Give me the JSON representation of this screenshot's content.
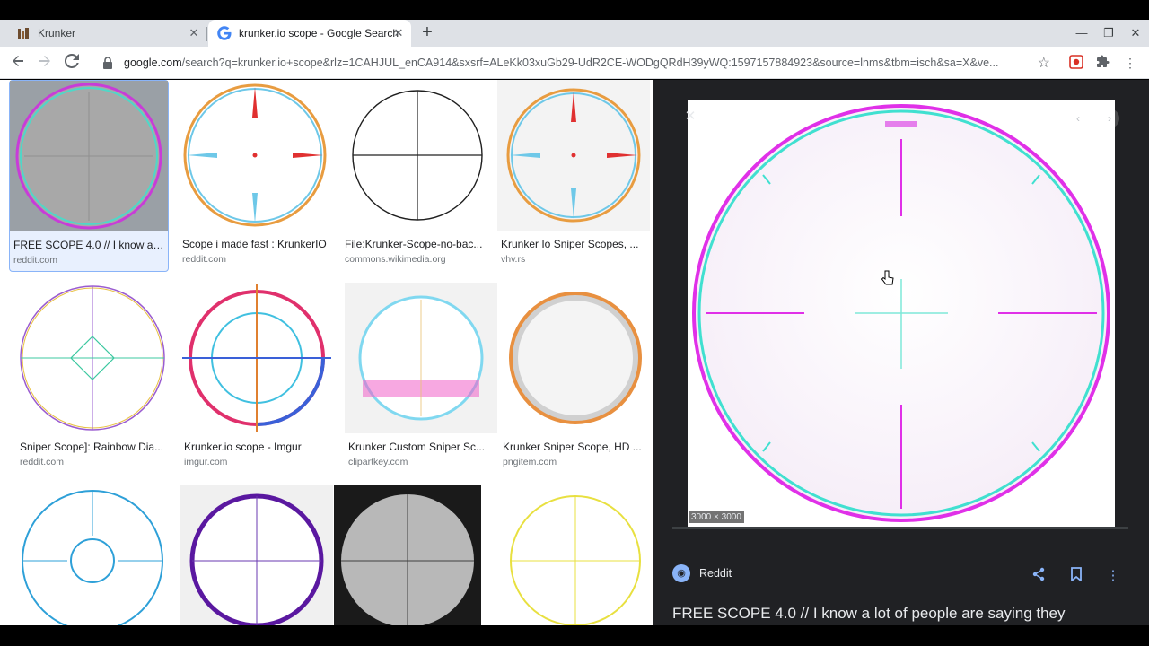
{
  "tabs": [
    {
      "title": "Krunker",
      "active": false
    },
    {
      "title": "krunker.io scope - Google Search",
      "active": true
    }
  ],
  "address": {
    "host": "google.com",
    "rest": "/search?q=krunker.io+scope&rlz=1CAHJUL_enCA914&sxsrf=ALeKk03xuGb29-UdR2CE-WODgQRdH39yWQ:1597157884923&source=lnms&tbm=isch&sa=X&ve..."
  },
  "results": [
    {
      "caption": "FREE SCOPE 4.0 // I know a ...",
      "source": "reddit.com"
    },
    {
      "caption": "Scope i made fast : KrunkerIO",
      "source": "reddit.com"
    },
    {
      "caption": "File:Krunker-Scope-no-bac...",
      "source": "commons.wikimedia.org"
    },
    {
      "caption": "Krunker Io Sniper Scopes, ...",
      "source": "vhv.rs"
    },
    {
      "caption": "Sniper Scope]: Rainbow Dia...",
      "source": "reddit.com"
    },
    {
      "caption": "Krunker.io scope - Imgur",
      "source": "imgur.com"
    },
    {
      "caption": "Krunker Custom Sniper Sc...",
      "source": "clipartkey.com"
    },
    {
      "caption": "Krunker Sniper Scope, HD ...",
      "source": "pngitem.com"
    }
  ],
  "preview": {
    "dimensions": "3000 × 3000",
    "source": "Reddit",
    "title": "FREE SCOPE 4.0 // I know a lot of people are saying they"
  },
  "colors": {
    "accent": "#8ab4f8",
    "panel": "#202124"
  }
}
